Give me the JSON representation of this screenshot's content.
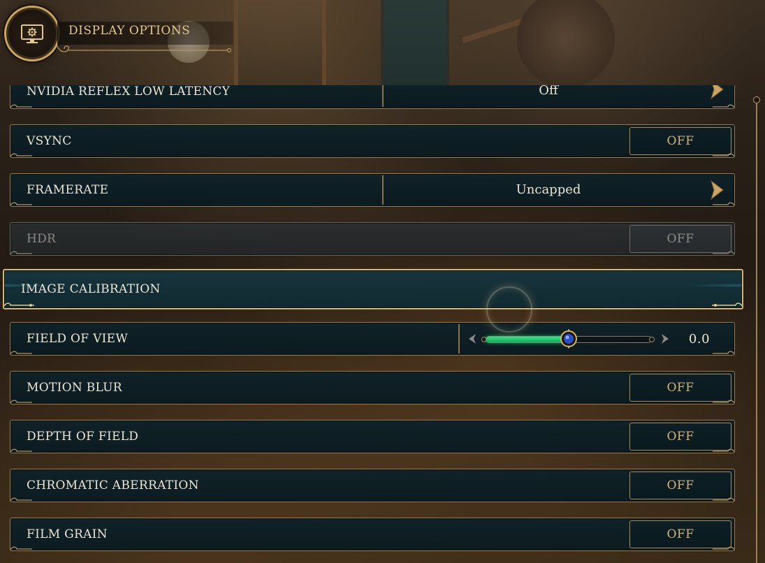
{
  "header": {
    "title": "DISPLAY OPTIONS",
    "icon": "display-settings-icon"
  },
  "colors": {
    "accent_gold": "#d6b66a",
    "row_background": "#0e2228",
    "toggle_text": "#d2b377",
    "slider_fill": "#26d06f"
  },
  "options": {
    "reflex": {
      "label": "NVIDIA REFLEX LOW LATENCY",
      "value": "Off"
    },
    "vsync": {
      "label": "VSYNC",
      "value": "OFF"
    },
    "framerate": {
      "label": "FRAMERATE",
      "value": "Uncapped"
    },
    "hdr": {
      "label": "HDR",
      "value": "OFF",
      "disabled": true
    },
    "image_calibration": {
      "label": "IMAGE CALIBRATION",
      "selected": true
    },
    "field_of_view": {
      "label": "FIELD OF VIEW",
      "value": "0.0",
      "slider_fraction": 0.5
    },
    "motion_blur": {
      "label": "MOTION BLUR",
      "value": "OFF"
    },
    "depth_of_field": {
      "label": "DEPTH OF FIELD",
      "value": "OFF"
    },
    "chromatic_aberration": {
      "label": "CHROMATIC ABERRATION",
      "value": "OFF"
    },
    "film_grain": {
      "label": "FILM GRAIN",
      "value": "OFF"
    }
  }
}
